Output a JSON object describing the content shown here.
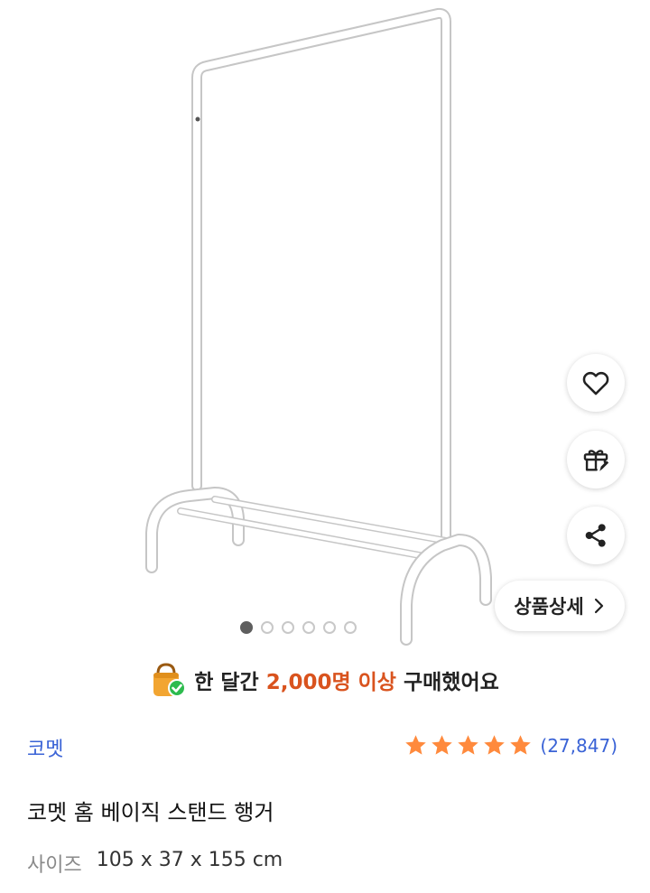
{
  "product": {
    "image_alt": "clothing rack",
    "carousel": {
      "total": 6,
      "active_index": 0
    },
    "detail_button_label": "상품상세",
    "purchase_banner": {
      "prefix": "한 달간",
      "highlight": "2,000명 이상",
      "suffix": "구매했어요"
    },
    "brand": "코멧",
    "rating": {
      "stars": 5,
      "count_label": "(27,847)"
    },
    "title": "코멧 홈 베이직 스탠드 행거",
    "spec": {
      "label": "사이즈",
      "value": "105 x 37 x 155 cm"
    }
  },
  "icons": {
    "wishlist": "heart-icon",
    "gift": "gift-icon",
    "share": "share-icon",
    "detail_chevron": "chevron-right-icon",
    "purchase_badge": "shopping-bag-check-icon",
    "star": "star-icon"
  },
  "colors": {
    "accent_orange": "#d9531e",
    "brand_blue": "#3a63d6",
    "star_orange": "#ff8a3d"
  }
}
